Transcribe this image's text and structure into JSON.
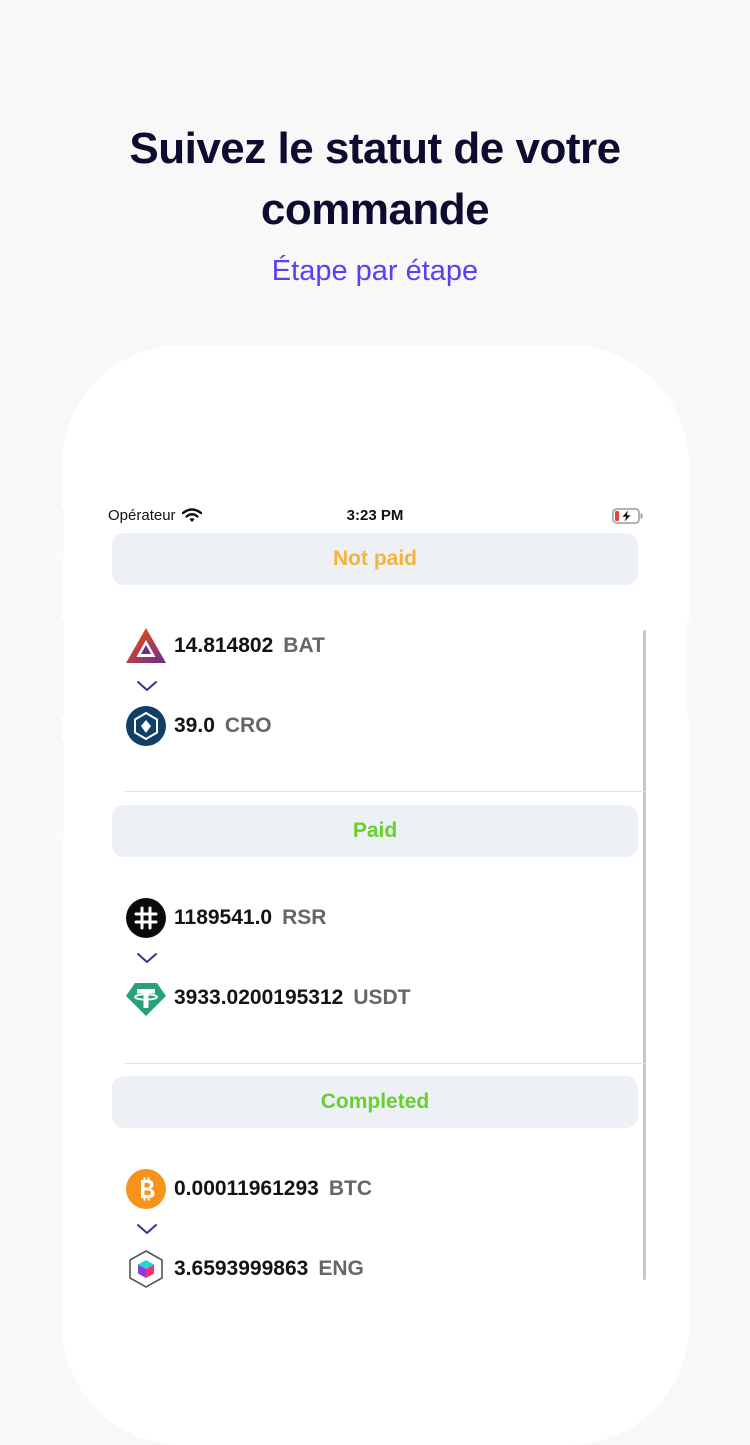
{
  "headline": {
    "line1": "Suivez le statut de votre",
    "line2": "commande"
  },
  "subheadline": "Étape par étape",
  "status_bar": {
    "carrier": "Opérateur",
    "time": "3:23 PM"
  },
  "colors": {
    "headline": "#0d0c2e",
    "accent": "#5b3ff2",
    "not_paid": "#f5b33a",
    "paid": "#66d02e",
    "completed": "#66d02e",
    "chevron": "#4b2a8c"
  },
  "orders": [
    {
      "status": "Not paid",
      "from": {
        "amount": "14.814802",
        "symbol": "BAT",
        "icon": "bat-coin-icon"
      },
      "to": {
        "amount": "39.0",
        "symbol": "CRO",
        "icon": "cro-coin-icon"
      }
    },
    {
      "status": "Paid",
      "from": {
        "amount": "1189541.0",
        "symbol": "RSR",
        "icon": "rsr-coin-icon"
      },
      "to": {
        "amount": "3933.0200195312",
        "symbol": "USDT",
        "icon": "usdt-coin-icon"
      }
    },
    {
      "status": "Completed",
      "from": {
        "amount": "0.00011961293",
        "symbol": "BTC",
        "icon": "btc-coin-icon"
      },
      "to": {
        "amount": "3.6593999863",
        "symbol": "ENG",
        "icon": "eng-coin-icon"
      }
    }
  ]
}
